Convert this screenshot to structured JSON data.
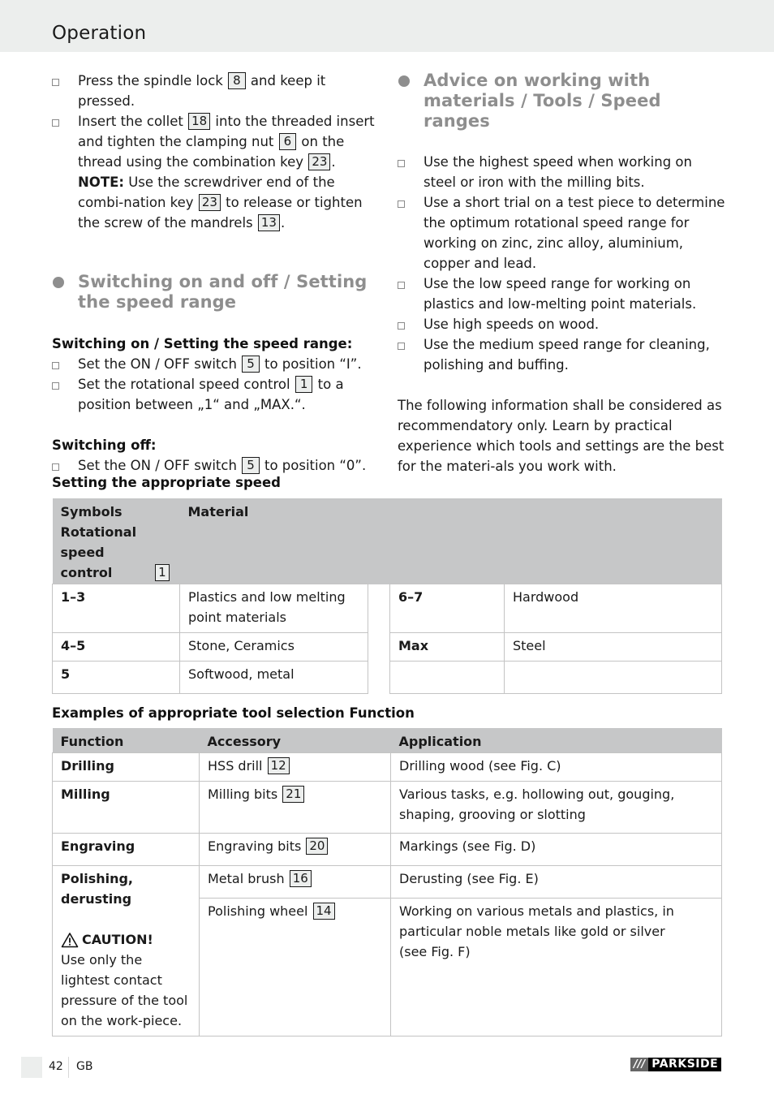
{
  "header": {
    "title": "Operation"
  },
  "left_column": {
    "intro_items": [
      {
        "parts": [
          "Press the spindle lock ",
          "8",
          " and keep it pressed."
        ]
      },
      {
        "parts": [
          "Insert the collet ",
          "18",
          " into the threaded insert and tighten the clamping nut ",
          "6",
          " on the thread using the combination key ",
          "23",
          "."
        ],
        "note_label": "NOTE:",
        "note_parts": [
          " Use the screwdriver end of the combi-nation key ",
          "23",
          " to release or tighten the screw of the mandrels ",
          "13",
          "."
        ]
      }
    ],
    "switching_heading": "Switching on and off / Setting the speed range",
    "switch_on_title": "Switching on / Setting the speed range:",
    "switch_on_items": [
      {
        "parts": [
          "Set the ON / OFF switch ",
          "5",
          " to position “I”."
        ]
      },
      {
        "parts": [
          "Set the rotational speed control ",
          "1",
          " to a position between „1“ and „MAX.“."
        ]
      }
    ],
    "switch_off_title": "Switching off:",
    "switch_off_items": [
      {
        "parts": [
          "Set the ON / OFF switch ",
          "5",
          " to position “0”."
        ]
      }
    ]
  },
  "right_column": {
    "advice_heading": "Advice on working with materials / Tools / Speed ranges",
    "advice_items": [
      "Use the highest speed when working on steel or iron with the milling bits.",
      "Use a short trial on a test piece to determine the optimum rotational speed range for working on zinc, zinc alloy, aluminium, copper and lead.",
      "Use the low speed range for working on plastics and low-melting point materials.",
      "Use high speeds on wood.",
      "Use the medium speed range for cleaning, polishing and buffing."
    ],
    "paragraph": "The following information shall be considered as recommendatory only. Learn by practical experience which tools and settings are the best for the materi-als you work with."
  },
  "speed_table": {
    "title": "Setting the appropriate speed",
    "header_symbols": "Symbols Rotational speed control",
    "header_symbols_ref": "1",
    "header_material": "Material",
    "rows": [
      {
        "speed": "1–3",
        "material": "Plastics and low melting point materials",
        "speed2": "6–7",
        "material2": "Hardwood"
      },
      {
        "speed": "4–5",
        "material": "Stone, Ceramics",
        "speed2": "Max",
        "material2": "Steel"
      },
      {
        "speed": "5",
        "material": "Softwood, metal",
        "speed2": "",
        "material2": ""
      }
    ]
  },
  "tool_table": {
    "title": "Examples of appropriate tool selection Function",
    "headers": [
      "Function",
      "Accessory",
      "Application"
    ],
    "rows": [
      {
        "function": "Drilling",
        "accessory": "HSS drill",
        "ref": "12",
        "application": "Drilling wood (see Fig. C)"
      },
      {
        "function": "Milling",
        "accessory": "Milling bits",
        "ref": "21",
        "application": "Various tasks, e.g. hollowing out, gouging, shaping, grooving or slotting"
      },
      {
        "function": "Engraving",
        "accessory": "Engraving bits",
        "ref": "20",
        "application": "Markings (see Fig. D)"
      },
      {
        "function": "Polishing, derusting",
        "accessory": "Metal brush",
        "ref": "16",
        "application": "Derusting (see Fig. E)"
      },
      {
        "function": "",
        "accessory": "Polishing wheel",
        "ref": "14",
        "application": "Working on various metals and plastics, in particular noble metals like gold or silver (see Fig. F)"
      }
    ],
    "caution_label": "CAUTION!",
    "caution_icon": "warning-triangle-icon",
    "caution_text": "Use only the lightest contact pressure of the tool on the work-piece."
  },
  "footer": {
    "page_number": "42",
    "language": "GB",
    "brand_slashes": "///",
    "brand_name": "PARKSIDE"
  },
  "colors": {
    "header_band": "#eceeed",
    "heading_gray": "#8e8e8e",
    "table_header": "#c6c7c8",
    "table_border": "#c4c4c4"
  }
}
